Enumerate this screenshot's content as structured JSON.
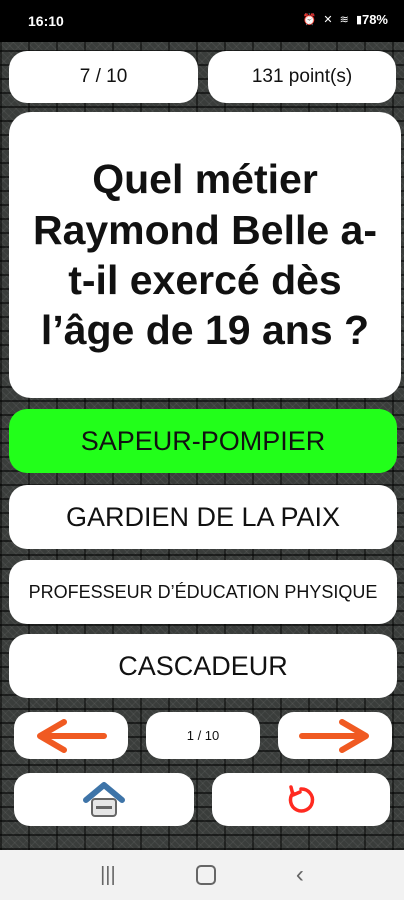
{
  "status_bar": {
    "time": "16:10",
    "icons": [
      "alarm-icon",
      "mute-icon",
      "wifi-icon",
      "signal-icon"
    ],
    "battery": "78%"
  },
  "header": {
    "question_counter": "7 / 10",
    "score": "131 point(s)"
  },
  "question": {
    "text": "Quel métier Raymond Belle a-t-il exercé dès l’âge de 19 ans ?"
  },
  "answers": [
    {
      "label": "SAPEUR-POMPIER",
      "state": "correct",
      "color": "#22ff1a"
    },
    {
      "label": "GARDIEN DE LA PAIX",
      "state": "normal"
    },
    {
      "label": "PROFESSEUR D’ÉDUCATION PHYSIQUE",
      "state": "normal"
    },
    {
      "label": "CASCADEUR",
      "state": "normal"
    }
  ],
  "navigation": {
    "page_indicator": "1 / 10",
    "prev_icon": "arrow-left-icon",
    "next_icon": "arrow-right-icon",
    "arrow_color": "#f05a22"
  },
  "bottom_actions": {
    "home_icon": "home-icon",
    "restart_icon": "restart-icon"
  },
  "system_nav": {
    "recent_icon": "recent-apps-icon",
    "home_icon": "system-home-icon",
    "back_icon": "back-icon"
  }
}
